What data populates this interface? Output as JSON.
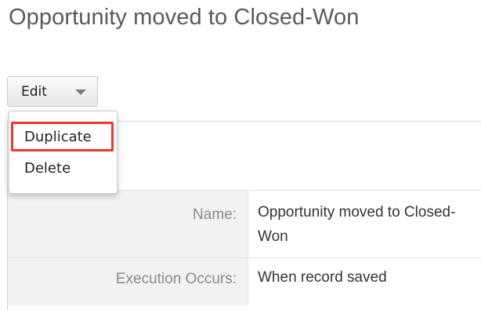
{
  "page": {
    "title": "Opportunity moved to Closed-Won"
  },
  "actions": {
    "edit_label": "Edit",
    "menu_items": [
      {
        "label": "Duplicate",
        "highlighted": true
      },
      {
        "label": "Delete",
        "highlighted": false
      }
    ]
  },
  "details": {
    "rows": [
      {
        "label": "Name:",
        "value": "Opportunity moved to Closed-Won"
      },
      {
        "label": "Execution Occurs:",
        "value": "When record saved"
      }
    ]
  },
  "colors": {
    "highlight": "#e8392b",
    "label_background": "#f2f2f2"
  }
}
